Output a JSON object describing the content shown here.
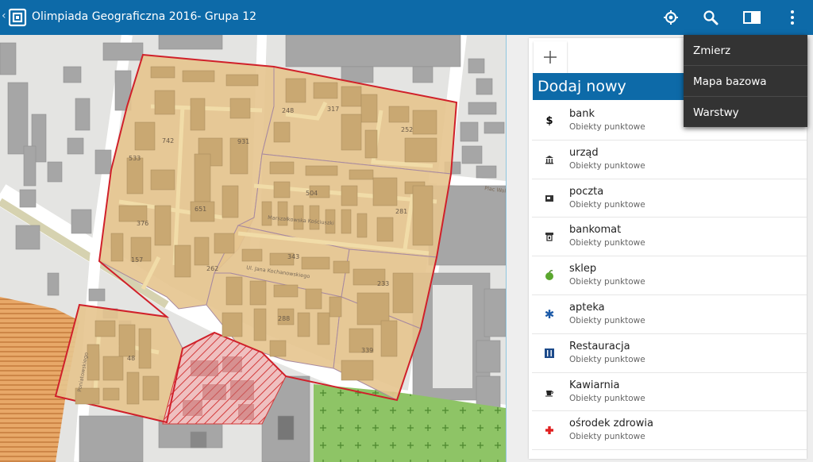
{
  "app": {
    "title": "Olimpiada Geograficzna 2016- Grupa 12"
  },
  "actionbar": {
    "icons": [
      "back-chevron-icon",
      "app-logo-icon",
      "locate-icon",
      "search-icon",
      "book-icon",
      "overflow-menu-icon"
    ]
  },
  "menu": {
    "items": [
      {
        "label": "Zmierz"
      },
      {
        "label": "Mapa bazowa"
      },
      {
        "label": "Warstwy"
      }
    ]
  },
  "panel": {
    "add_icon": "plus-icon",
    "header": "Dodaj nowy",
    "items": [
      {
        "name": "bank",
        "sub": "Obiekty punktowe",
        "icon": "dollar-icon",
        "color": "#000000"
      },
      {
        "name": "urząd",
        "sub": "Obiekty punktowe",
        "icon": "government-building-icon",
        "color": "#333333"
      },
      {
        "name": "poczta",
        "sub": "Obiekty punktowe",
        "icon": "post-office-icon",
        "color": "#333333"
      },
      {
        "name": "bankomat",
        "sub": "Obiekty punktowe",
        "icon": "atm-icon",
        "color": "#333333"
      },
      {
        "name": "sklep",
        "sub": "Obiekty punktowe",
        "icon": "apple-shop-icon",
        "color": "#5aa72e"
      },
      {
        "name": "apteka",
        "sub": "Obiekty punktowe",
        "icon": "star-of-life-icon",
        "color": "#1c5aa8"
      },
      {
        "name": "Restauracja",
        "sub": "Obiekty punktowe",
        "icon": "restaurant-icon",
        "color": "#1c4a8a"
      },
      {
        "name": "Kawiarnia",
        "sub": "Obiekty punktowe",
        "icon": "coffee-cup-icon",
        "color": "#222222"
      },
      {
        "name": "ośrodek zdrowia",
        "sub": "Obiekty punktowe",
        "icon": "red-cross-icon",
        "color": "#e02020"
      }
    ]
  },
  "map": {
    "colors": {
      "district_fill": "#e6c48e",
      "district_border": "#d0202a",
      "hatched": "#d33a3a",
      "park": "#8ec466",
      "buildings": "#a6a6a6",
      "background": "#e4e4e2"
    },
    "labels": [
      "742",
      "931",
      "533",
      "651",
      "504",
      "376",
      "262",
      "157",
      "343",
      "233",
      "288",
      "339",
      "281",
      "252",
      "317",
      "248",
      "48"
    ],
    "street_labels": [
      "Marszałkowska Kościuszki",
      "Ul. Jana Kochanowskiego",
      "Plac Wolności",
      "Poniatowskiego"
    ]
  }
}
